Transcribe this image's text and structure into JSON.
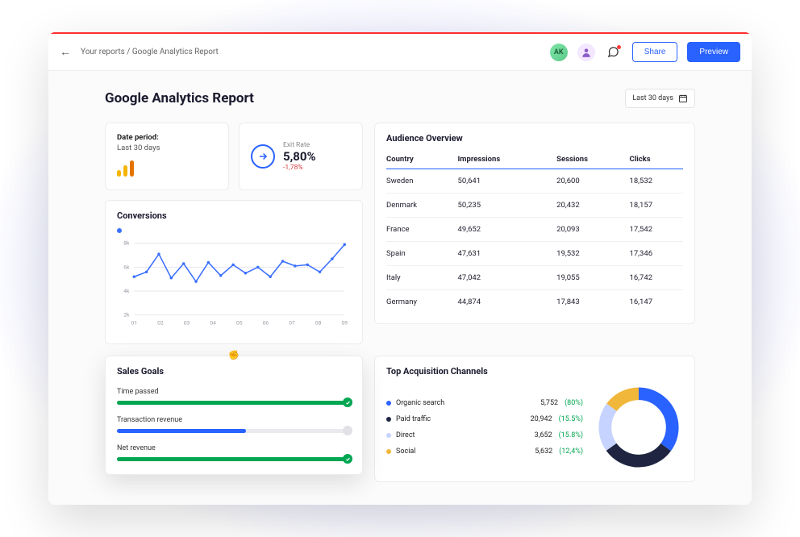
{
  "breadcrumb": {
    "root": "Your reports",
    "sep": " / ",
    "current": "Google Analytics Report"
  },
  "topbar": {
    "avatar1": "AK",
    "share": "Share",
    "preview": "Preview"
  },
  "title": "Google Analytics Report",
  "date_filter": "Last 30 days",
  "date_period_card": {
    "label": "Date period:",
    "value": "Last 30 days"
  },
  "exit_rate": {
    "label": "Exit Rate",
    "value": "5,80%",
    "delta": "-1,78%"
  },
  "conversions_title": "Conversions",
  "audience": {
    "title": "Audience Overview",
    "headers": [
      "Country",
      "Impressions",
      "Sessions",
      "Clicks"
    ],
    "rows": [
      {
        "country": "Sweden",
        "impressions": "50,641",
        "sessions": "20,600",
        "clicks": "18,532"
      },
      {
        "country": "Denmark",
        "impressions": "50,235",
        "sessions": "20,432",
        "clicks": "18,157"
      },
      {
        "country": "France",
        "impressions": "49,652",
        "sessions": "20,093",
        "clicks": "17,542"
      },
      {
        "country": "Spain",
        "impressions": "47,631",
        "sessions": "19,532",
        "clicks": "17,346"
      },
      {
        "country": "Italy",
        "impressions": "47,042",
        "sessions": "19,055",
        "clicks": "16,742"
      },
      {
        "country": "Germany",
        "impressions": "44,874",
        "sessions": "17,843",
        "clicks": "16,147"
      }
    ]
  },
  "sales": {
    "title": "Sales Goals",
    "goals": [
      {
        "label": "Time passed",
        "pct": 100,
        "color": "green",
        "done": true
      },
      {
        "label": "Transaction revenue",
        "pct": 55,
        "color": "blue",
        "done": false
      },
      {
        "label": "Net revenue",
        "pct": 100,
        "color": "green",
        "done": true
      }
    ]
  },
  "acq": {
    "title": "Top Acquisition Channels",
    "items": [
      {
        "name": "Organic search",
        "value": "5,752",
        "pct": "(80%)",
        "color": "d-blue"
      },
      {
        "name": "Paid traffic",
        "value": "20,942",
        "pct": "(15.5%)",
        "color": "d-dark"
      },
      {
        "name": "Direct",
        "value": "3,652",
        "pct": "(15.8%)",
        "color": "d-light"
      },
      {
        "name": "Social",
        "value": "5,632",
        "pct": "(12,4%)",
        "color": "d-yellow"
      }
    ]
  },
  "chart_data": [
    {
      "type": "line",
      "title": "Conversions",
      "categories": [
        "01",
        "02",
        "03",
        "04",
        "05",
        "06",
        "07",
        "08",
        "09"
      ],
      "ylabels": [
        "2k",
        "4k",
        "6k",
        "8k"
      ],
      "ylim": [
        2000,
        8000
      ],
      "values": [
        5200,
        5600,
        7100,
        5100,
        6300,
        4800,
        6400,
        5300,
        6200,
        5500,
        6000,
        5200,
        6500,
        6100,
        6200,
        5600,
        6700,
        7900
      ],
      "note": "18 points across 9 labeled x-ticks (two samples per tick)"
    },
    {
      "type": "pie",
      "title": "Top Acquisition Channels",
      "series": [
        {
          "name": "Organic search",
          "value": 5752,
          "share": 0.35,
          "color": "#2962ff"
        },
        {
          "name": "Paid traffic",
          "value": 20942,
          "share": 0.3,
          "color": "#1f2540"
        },
        {
          "name": "Direct",
          "value": 3652,
          "share": 0.2,
          "color": "#c7d3ff"
        },
        {
          "name": "Social",
          "value": 5632,
          "share": 0.15,
          "color": "#f0b73a"
        }
      ]
    }
  ]
}
